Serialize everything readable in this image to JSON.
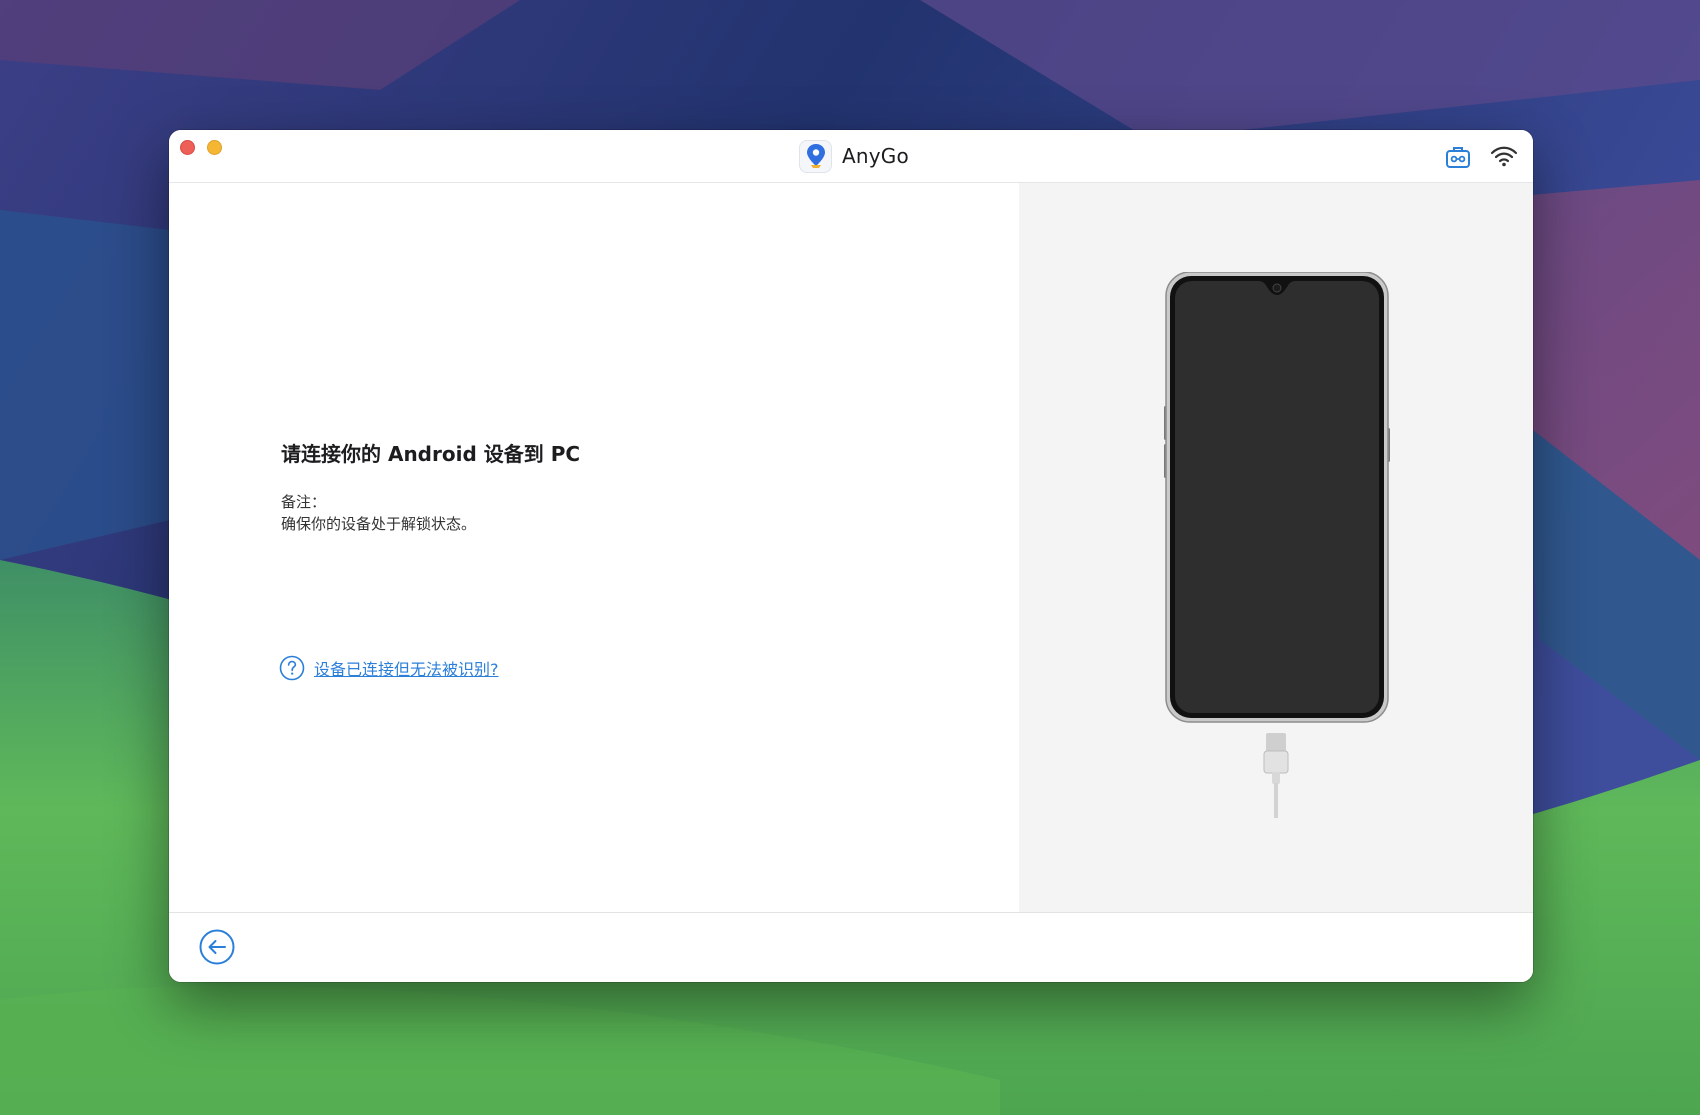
{
  "window": {
    "app_name": "AnyGo",
    "controls": [
      "close",
      "minimize"
    ],
    "toolbar_icons": [
      "toolbox-icon",
      "wifi-icon"
    ]
  },
  "main": {
    "heading": "请连接你的 Android 设备到 PC",
    "note_label": "备注：",
    "note_text": "确保你的设备处于解锁状态。",
    "help_link": "设备已连接但无法被识别?"
  },
  "footer": {
    "back_icon": "arrow-left-circle-icon"
  },
  "colors": {
    "accent": "#2b7fd9",
    "close": "#ee5f57",
    "minimize": "#f5b633",
    "right_pane_bg": "#f4f4f4",
    "phone_screen": "#2e2e2e"
  }
}
